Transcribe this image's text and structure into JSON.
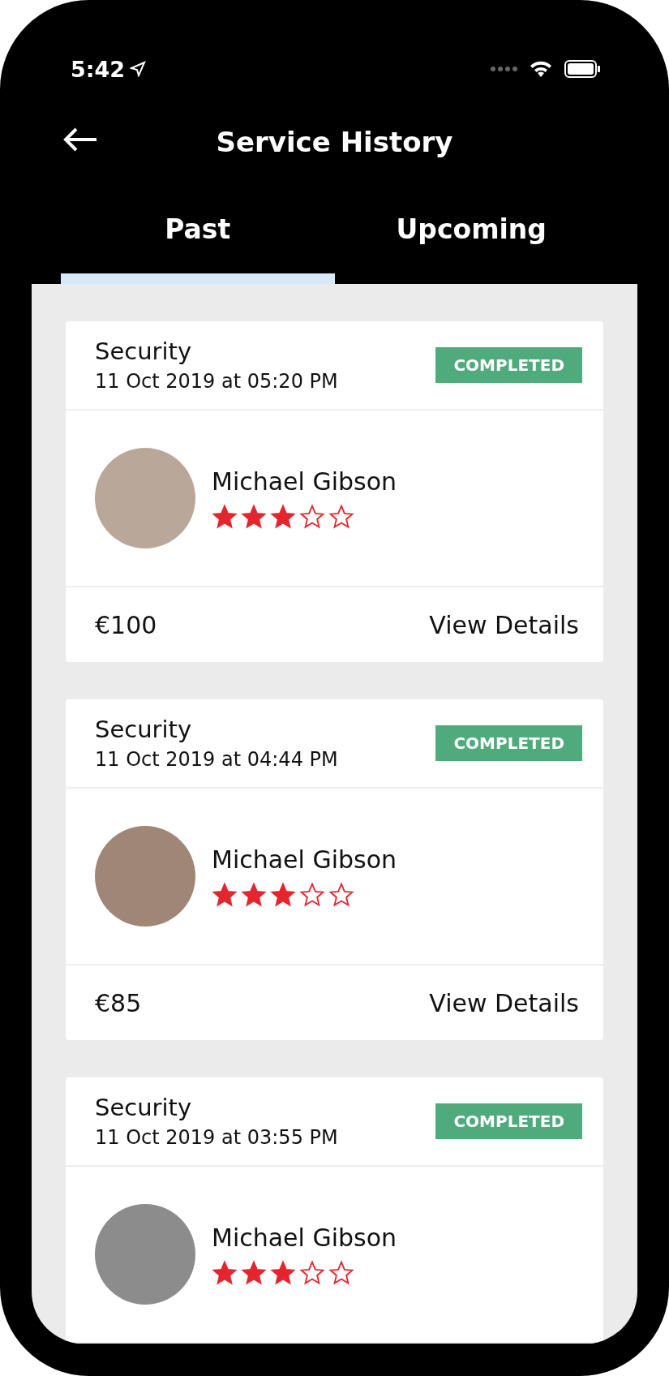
{
  "status_bar": {
    "time": "5:42"
  },
  "header": {
    "title": "Service History"
  },
  "tabs": [
    {
      "label": "Past",
      "selected": true
    },
    {
      "label": "Upcoming",
      "selected": false
    }
  ],
  "cards": [
    {
      "service": "Security",
      "datetime": "11 Oct 2019 at 05:20 PM",
      "status": "COMPLETED",
      "name": "Michael Gibson",
      "stars": 3,
      "price": "€100",
      "action": "View Details"
    },
    {
      "service": "Security",
      "datetime": "11 Oct 2019 at 04:44 PM",
      "status": "COMPLETED",
      "name": "Michael Gibson",
      "stars": 3,
      "price": "€85",
      "action": "View Details"
    },
    {
      "service": "Security",
      "datetime": "11 Oct 2019 at 03:55 PM",
      "status": "COMPLETED",
      "name": "Michael Gibson",
      "stars": 3
    }
  ]
}
